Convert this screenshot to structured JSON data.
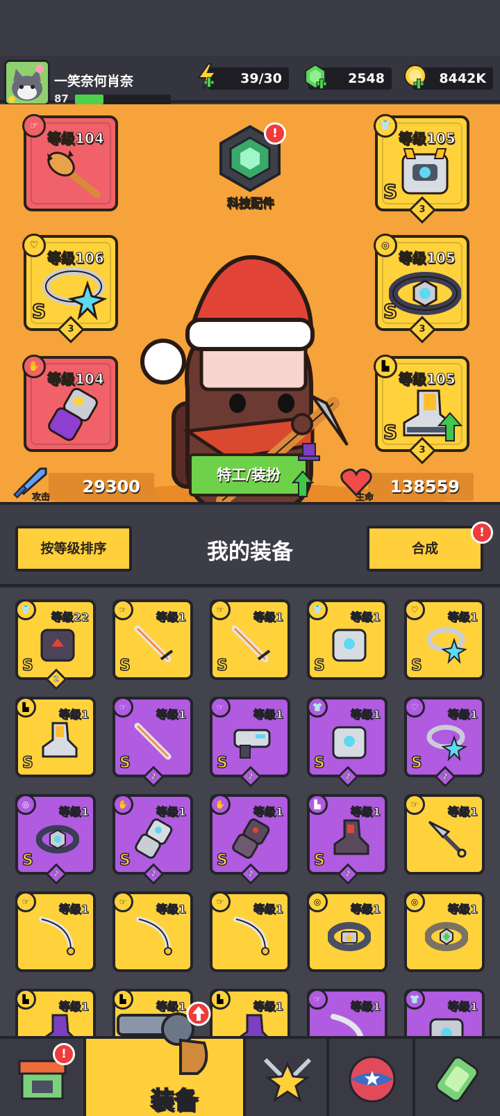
{
  "player": {
    "name": "一笑奈何肖奈",
    "level": "87",
    "xp_fraction": 0.3
  },
  "resources": {
    "energy": "39/30",
    "gems": "2548",
    "coins": "8442K"
  },
  "hero": {
    "tech_label": "科技配件",
    "alert": "!",
    "agent_button": "特工/装扮",
    "attack_label": "攻击",
    "attack_value": "29300",
    "hp_label": "生命",
    "hp_value": "138559"
  },
  "equipped": [
    {
      "level": "等级104",
      "grade": "",
      "stars": ""
    },
    {
      "level": "等级106",
      "grade": "S",
      "stars": "3"
    },
    {
      "level": "等级104",
      "grade": "",
      "stars": ""
    },
    {
      "level": "等级105",
      "grade": "S",
      "stars": "3"
    },
    {
      "level": "等级105",
      "grade": "S",
      "stars": "3"
    },
    {
      "level": "等级105",
      "grade": "S",
      "stars": "3"
    }
  ],
  "bag": {
    "sort_button": "按等级排序",
    "title": "我的装备",
    "merge_button": "合成",
    "alert": "!"
  },
  "items": [
    {
      "level": "等级22",
      "grade": "S",
      "stars": "2"
    },
    {
      "level": "等级1",
      "grade": "S",
      "stars": ""
    },
    {
      "level": "等级1",
      "grade": "S",
      "stars": ""
    },
    {
      "level": "等级1",
      "grade": "S",
      "stars": ""
    },
    {
      "level": "等级1",
      "grade": "S",
      "stars": ""
    },
    {
      "level": "等级1",
      "grade": "S",
      "stars": ""
    },
    {
      "level": "等级1",
      "grade": "S",
      "stars": "2"
    },
    {
      "level": "等级1",
      "grade": "S",
      "stars": "2"
    },
    {
      "level": "等级1",
      "grade": "S",
      "stars": "2"
    },
    {
      "level": "等级1",
      "grade": "S",
      "stars": "2"
    },
    {
      "level": "等级1",
      "grade": "S",
      "stars": "2"
    },
    {
      "level": "等级1",
      "grade": "S",
      "stars": "2"
    },
    {
      "level": "等级1",
      "grade": "S",
      "stars": "2"
    },
    {
      "level": "等级1",
      "grade": "S",
      "stars": "2"
    },
    {
      "level": "等级1",
      "grade": "",
      "stars": ""
    },
    {
      "level": "等级1",
      "grade": "",
      "stars": ""
    },
    {
      "level": "等级1",
      "grade": "",
      "stars": ""
    },
    {
      "level": "等级1",
      "grade": "",
      "stars": ""
    },
    {
      "level": "等级1",
      "grade": "",
      "stars": ""
    },
    {
      "level": "等级1",
      "grade": "",
      "stars": ""
    },
    {
      "level": "等级1",
      "grade": "",
      "stars": ""
    },
    {
      "level": "等级1",
      "grade": "",
      "stars": ""
    },
    {
      "level": "等级1",
      "grade": "",
      "stars": ""
    },
    {
      "level": "等级1",
      "grade": "",
      "stars": ""
    },
    {
      "level": "等级1",
      "grade": "",
      "stars": ""
    }
  ],
  "nav": {
    "active_label": "装备",
    "alert": "!"
  },
  "colors": {
    "orange_bg": "#f5a33a",
    "gold": "#ffd23c",
    "purple": "#b05be0",
    "red": "#f0616a",
    "green": "#6ed14a"
  }
}
